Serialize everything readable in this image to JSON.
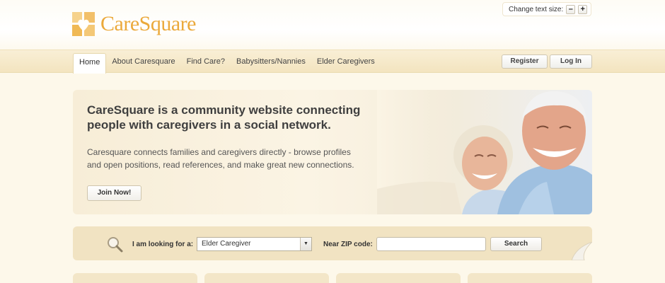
{
  "brand": {
    "name": "CareSquare"
  },
  "text_size": {
    "label": "Change text size:",
    "decrease": "–",
    "increase": "+"
  },
  "nav": {
    "tabs": [
      {
        "label": "Home",
        "active": true
      },
      {
        "label": "About Caresquare"
      },
      {
        "label": "Find Care?"
      },
      {
        "label": "Babysitters/Nannies"
      },
      {
        "label": "Elder Caregivers"
      }
    ],
    "register_label": "Register",
    "login_label": "Log In"
  },
  "hero": {
    "headline": "CareSquare is a community website connecting people with caregivers in a social network.",
    "body": "Caresquare connects families and caregivers directly - browse profiles and open positions, read references, and make great new connections.",
    "cta_label": "Join Now!"
  },
  "search": {
    "looking_for_label": "I am looking for a:",
    "looking_for_value": "Elder Caregiver",
    "zip_label": "Near ZIP code:",
    "zip_value": "",
    "button_label": "Search"
  },
  "colors": {
    "brand_orange": "#eba93b",
    "nav_band": "#f3e4bf",
    "search_band": "#f1e3c2"
  }
}
